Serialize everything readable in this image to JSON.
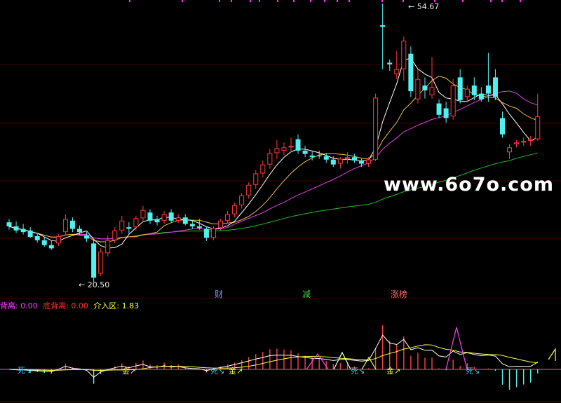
{
  "chart_data": {
    "type": "candlestick",
    "title": "",
    "price_labels": {
      "high": "54.67",
      "low": "20.50"
    },
    "watermark": "www.6o7o.com",
    "event_tags": [
      {
        "text": "财",
        "color": "#5aa0ff"
      },
      {
        "text": "减",
        "color": "#40d040"
      },
      {
        "text": "涨榜",
        "color": "#ff6060"
      }
    ],
    "indicator_legend": [
      {
        "label": "背离: 0.00",
        "color": "#ff40ff"
      },
      {
        "label": "底背离: 0.00",
        "color": "#ff3030"
      },
      {
        "label": "介入区: 1.83",
        "color": "#ffff40"
      }
    ],
    "signals": [
      {
        "text": "死",
        "color": "#4fc3ff"
      },
      {
        "text": "金",
        "color": "#ffff40"
      },
      {
        "text": "死",
        "color": "#4fc3ff"
      },
      {
        "text": "金",
        "color": "#ffff40"
      },
      {
        "text": "死",
        "color": "#4fc3ff"
      },
      {
        "text": "金",
        "color": "#ffff40"
      },
      {
        "text": "死",
        "color": "#4fc3ff"
      }
    ],
    "candles": [
      [
        27.8,
        28.2,
        26.9,
        27.3
      ],
      [
        27.3,
        27.9,
        26.5,
        26.8
      ],
      [
        27.0,
        27.6,
        26.3,
        26.6
      ],
      [
        26.8,
        27.2,
        25.9,
        26.0
      ],
      [
        26.1,
        26.5,
        25.3,
        25.6
      ],
      [
        25.6,
        26.0,
        24.8,
        25.0
      ],
      [
        25.0,
        25.6,
        24.4,
        24.6
      ],
      [
        25.2,
        26.4,
        24.9,
        26.1
      ],
      [
        26.6,
        28.8,
        26.2,
        28.2
      ],
      [
        28.0,
        28.4,
        26.6,
        27.0
      ],
      [
        27.0,
        27.4,
        26.2,
        26.6
      ],
      [
        26.2,
        26.6,
        25.4,
        25.8
      ],
      [
        25.2,
        25.6,
        20.5,
        21.0
      ],
      [
        21.5,
        24.6,
        21.2,
        24.2
      ],
      [
        24.0,
        26.2,
        23.6,
        25.6
      ],
      [
        25.6,
        27.2,
        25.2,
        26.8
      ],
      [
        26.8,
        28.6,
        26.4,
        28.0
      ],
      [
        27.2,
        27.8,
        26.4,
        27.0
      ],
      [
        27.2,
        28.6,
        26.8,
        28.3
      ],
      [
        28.3,
        29.8,
        27.8,
        29.3
      ],
      [
        29.0,
        29.4,
        27.6,
        28.0
      ],
      [
        28.2,
        28.6,
        27.4,
        27.8
      ],
      [
        28.0,
        29.2,
        27.6,
        28.8
      ],
      [
        29.0,
        29.4,
        27.8,
        28.0
      ],
      [
        28.0,
        28.8,
        27.7,
        28.4
      ],
      [
        28.4,
        28.8,
        27.4,
        27.6
      ],
      [
        27.6,
        28.0,
        27.0,
        27.3
      ],
      [
        27.3,
        28.2,
        26.9,
        27.1
      ],
      [
        27.0,
        27.3,
        25.5,
        25.9
      ],
      [
        25.9,
        27.3,
        25.6,
        27.1
      ],
      [
        27.1,
        28.2,
        26.8,
        28.0
      ],
      [
        28.0,
        29.2,
        27.7,
        28.8
      ],
      [
        28.8,
        30.2,
        28.4,
        29.9
      ],
      [
        29.9,
        31.4,
        29.5,
        31.1
      ],
      [
        31.1,
        32.7,
        30.7,
        32.4
      ],
      [
        32.4,
        34.2,
        31.9,
        33.8
      ],
      [
        33.8,
        35.4,
        33.3,
        34.9
      ],
      [
        34.9,
        36.8,
        34.4,
        36.3
      ],
      [
        36.3,
        37.9,
        35.6,
        36.9
      ],
      [
        36.6,
        37.6,
        36.0,
        37.0
      ],
      [
        37.0,
        38.2,
        36.4,
        37.2
      ],
      [
        38.0,
        38.6,
        36.2,
        36.6
      ],
      [
        36.6,
        37.2,
        35.8,
        36.2
      ],
      [
        36.0,
        36.6,
        35.4,
        35.8
      ],
      [
        36.0,
        36.6,
        35.6,
        35.9
      ],
      [
        35.9,
        36.3,
        35.1,
        35.5
      ],
      [
        35.5,
        35.9,
        34.6,
        34.9
      ],
      [
        35.0,
        35.8,
        34.4,
        35.6
      ],
      [
        35.6,
        36.4,
        35.0,
        35.8
      ],
      [
        35.8,
        36.2,
        35.1,
        35.4
      ],
      [
        35.4,
        35.6,
        34.6,
        35.0
      ],
      [
        35.0,
        35.8,
        34.6,
        35.5
      ],
      [
        35.5,
        43.6,
        35.3,
        43.1
      ],
      [
        52.0,
        54.67,
        46.6,
        51.8
      ],
      [
        47.4,
        47.8,
        46.4,
        47.2
      ],
      [
        46.0,
        48.8,
        45.4,
        46.6
      ],
      [
        46.6,
        50.6,
        45.2,
        50.1
      ],
      [
        48.5,
        49.4,
        43.2,
        43.9
      ],
      [
        42.9,
        46.6,
        42.4,
        45.4
      ],
      [
        44.6,
        45.6,
        43.0,
        44.0
      ],
      [
        43.4,
        48.1,
        43.0,
        44.4
      ],
      [
        42.4,
        42.9,
        40.6,
        41.0
      ],
      [
        41.8,
        42.6,
        40.0,
        40.6
      ],
      [
        40.8,
        45.4,
        40.4,
        44.6
      ],
      [
        45.6,
        46.6,
        42.4,
        42.8
      ],
      [
        43.2,
        44.6,
        42.6,
        44.2
      ],
      [
        44.6,
        45.6,
        42.8,
        43.4
      ],
      [
        43.6,
        44.4,
        42.6,
        42.9
      ],
      [
        44.6,
        48.6,
        42.6,
        43.6
      ],
      [
        45.6,
        46.6,
        42.8,
        43.2
      ],
      [
        40.6,
        41.4,
        38.2,
        38.6
      ],
      [
        36.4,
        37.4,
        35.6,
        37.0
      ],
      [
        37.4,
        37.9,
        37.0,
        37.6
      ],
      [
        37.6,
        38.2,
        37.2,
        37.8
      ],
      [
        37.8,
        38.4,
        37.2,
        38.0
      ],
      [
        38.0,
        43.6,
        37.8,
        40.8
      ]
    ]
  }
}
